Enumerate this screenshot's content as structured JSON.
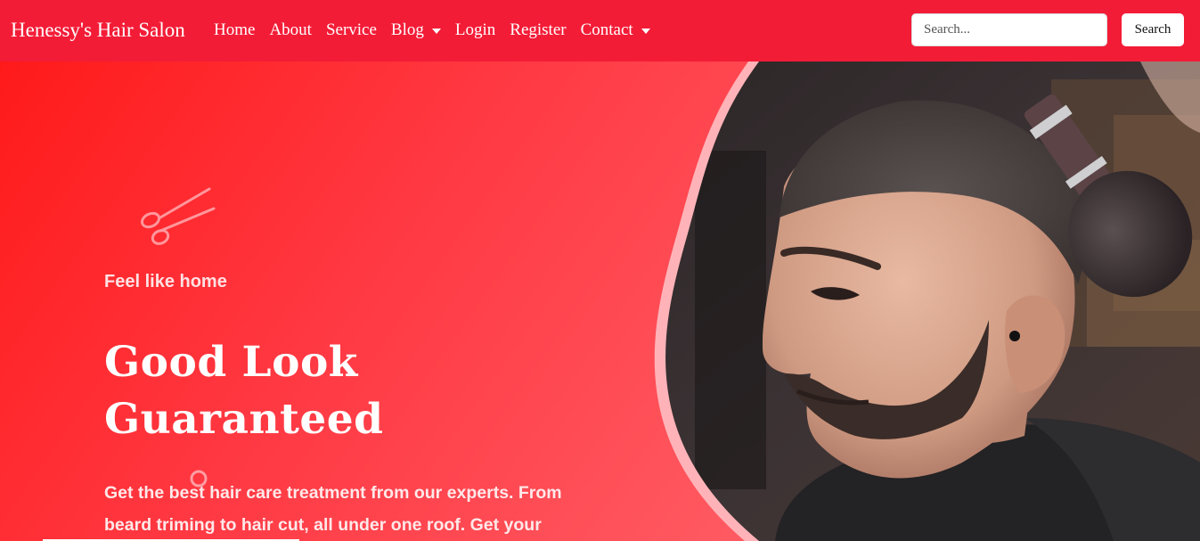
{
  "navbar": {
    "brand": "Henessy's Hair Salon",
    "links": [
      {
        "label": "Home"
      },
      {
        "label": "About"
      },
      {
        "label": "Service"
      },
      {
        "label": "Blog",
        "dropdown": true
      },
      {
        "label": "Login"
      },
      {
        "label": "Register"
      },
      {
        "label": "Contact",
        "dropdown": true
      }
    ],
    "search": {
      "placeholder": "Search...",
      "value": "",
      "button_label": "Search"
    }
  },
  "hero": {
    "tagline": "Feel like home",
    "headline_line1": "Good Look",
    "headline_line2": "Guaranteed",
    "description": "Get the best hair care treatment from our experts. From beard triming to hair cut, all under one roof. Get your",
    "icons": [
      "scissors-icon",
      "ring-icon"
    ]
  },
  "colors": {
    "navbar_bg": "#f31c37",
    "hero_gradient_start": "#ff1a1a",
    "hero_gradient_end": "#ff6f74",
    "text_white": "#ffffff"
  }
}
